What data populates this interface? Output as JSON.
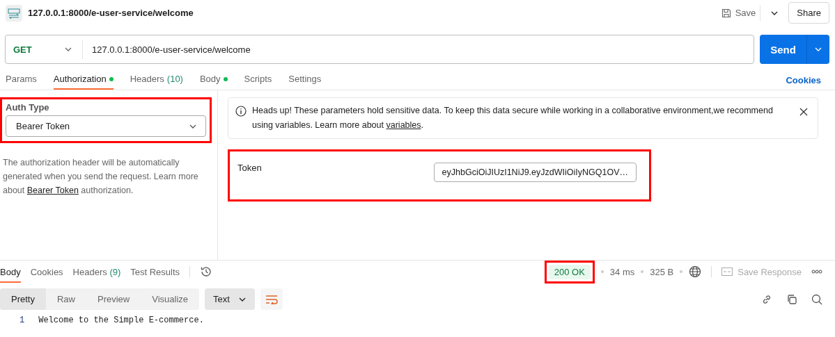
{
  "header": {
    "title": "127.0.0.1:8000/e-user-service/welcome",
    "save": "Save",
    "share": "Share"
  },
  "request": {
    "method": "GET",
    "url": "127.0.0.1:8000/e-user-service/welcome",
    "send": "Send"
  },
  "tabs": [
    {
      "label": "Params",
      "selected": false,
      "dot": false
    },
    {
      "label": "Authorization",
      "selected": true,
      "dot": true
    },
    {
      "label": "Headers",
      "count": "(10)",
      "selected": false,
      "dot": false
    },
    {
      "label": "Body",
      "selected": false,
      "dot": true
    },
    {
      "label": "Scripts",
      "selected": false,
      "dot": false
    },
    {
      "label": "Settings",
      "selected": false,
      "dot": false
    }
  ],
  "cookies_link": "Cookies",
  "auth": {
    "label": "Auth Type",
    "value": "Bearer Token",
    "highlighted": true,
    "description": "The authorization header will be automatically generated when you send the request. Learn more about ",
    "description_link": "Bearer Token",
    "description_end": " authorization."
  },
  "notice": {
    "text": "Heads up! These parameters hold sensitive data. To keep this data secure while working in a collaborative environment,we recommend using variables. Learn more about ",
    "link": "variables",
    "end": "."
  },
  "token": {
    "label": "Token",
    "value": "eyJhbGciOiJIUzI1NiJ9.eyJzdWIiOiIyNGQ1OV…",
    "highlighted": true
  },
  "response": {
    "tabs": [
      {
        "label": "Body",
        "selected": true
      },
      {
        "label": "Cookies",
        "selected": false
      },
      {
        "label": "Headers",
        "count": "(9)",
        "selected": false
      },
      {
        "label": "Test Results",
        "selected": false
      }
    ],
    "status": {
      "text": "200 OK",
      "highlighted": true
    },
    "time": "34 ms",
    "size": "325 B",
    "save_response": "Save Response",
    "formats": [
      {
        "label": "Pretty",
        "selected": true
      },
      {
        "label": "Raw",
        "selected": false
      },
      {
        "label": "Preview",
        "selected": false
      },
      {
        "label": "Visualize",
        "selected": false
      }
    ],
    "language": "Text",
    "lines": [
      {
        "number": "1",
        "text": "Welcome to the Simple E-commerce."
      }
    ]
  }
}
